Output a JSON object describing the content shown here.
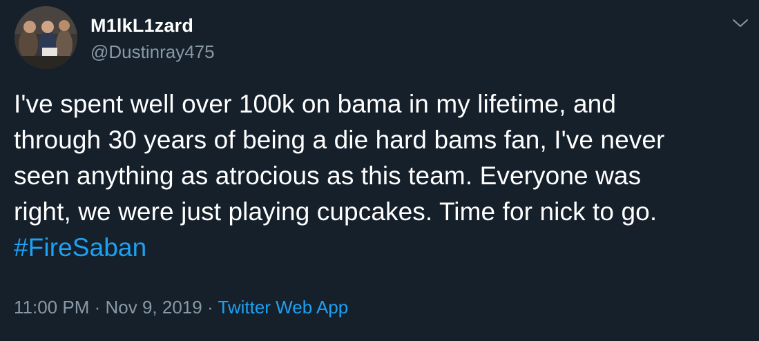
{
  "tweet": {
    "display_name": "M1lkL1zard",
    "handle": "@Dustinray475",
    "text_lines": [
      "I've spent well over 100k on bama in my lifetime, and",
      "through 30 years of being a die hard bams fan, I've never",
      "seen anything as atrocious as this team. Everyone was",
      "right, we were just playing cupcakes. Time for nick to go."
    ],
    "hashtag": "#FireSaban",
    "time": "11:00 PM",
    "separator": "·",
    "date": "Nov 9, 2019",
    "source": "Twitter Web App"
  },
  "icons": {
    "more": "chevron-down-icon"
  },
  "colors": {
    "background": "#15202b",
    "primary_text": "#ffffff",
    "secondary_text": "#8899a6",
    "accent": "#1da1f2"
  }
}
